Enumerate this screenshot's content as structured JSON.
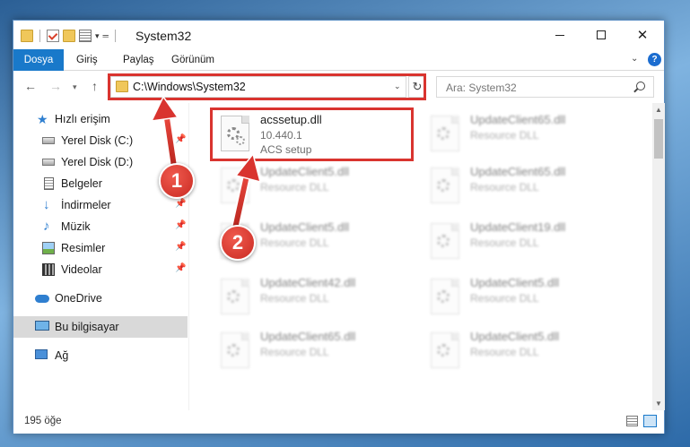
{
  "window": {
    "title": "System32"
  },
  "ribbon": {
    "tabs": [
      "Dosya",
      "Giriş",
      "Paylaş",
      "Görünüm"
    ],
    "help": "?"
  },
  "nav": {
    "address": "C:\\Windows\\System32",
    "search_placeholder": "Ara: System32"
  },
  "sidebar": {
    "items": [
      {
        "label": "Hızlı erişim",
        "icon": "star-icon",
        "pinned": false
      },
      {
        "label": "Yerel Disk (C:)",
        "icon": "drive-icon",
        "pinned": true
      },
      {
        "label": "Yerel Disk (D:)",
        "icon": "drive-icon",
        "pinned": false
      },
      {
        "label": "Belgeler",
        "icon": "documents-icon",
        "pinned": true
      },
      {
        "label": "İndirmeler",
        "icon": "downloads-icon",
        "pinned": true
      },
      {
        "label": "Müzik",
        "icon": "music-icon",
        "pinned": true
      },
      {
        "label": "Resimler",
        "icon": "pictures-icon",
        "pinned": true
      },
      {
        "label": "Videolar",
        "icon": "videos-icon",
        "pinned": true
      },
      {
        "label": "OneDrive",
        "icon": "onedrive-icon",
        "pinned": false
      },
      {
        "label": "Bu bilgisayar",
        "icon": "this-pc-icon",
        "pinned": false,
        "selected": true
      },
      {
        "label": "Ağ",
        "icon": "network-icon",
        "pinned": false
      }
    ]
  },
  "files": [
    {
      "name": "acssetup.dll",
      "line1": "10.440.1",
      "line2": "ACS setup",
      "highlighted": true
    },
    {
      "name": "UpdateClient65.dll",
      "line1": "Resource DLL",
      "line2": ""
    },
    {
      "name": "UpdateClient5.dll",
      "line1": "Resource DLL",
      "line2": ""
    },
    {
      "name": "UpdateClient65.dll",
      "line1": "Resource DLL",
      "line2": ""
    },
    {
      "name": "UpdateClient5.dll",
      "line1": "Resource DLL",
      "line2": ""
    },
    {
      "name": "UpdateClient19.dll",
      "line1": "Resource DLL",
      "line2": ""
    },
    {
      "name": "UpdateClient42.dll",
      "line1": "Resource DLL",
      "line2": ""
    },
    {
      "name": "UpdateClient5.dll",
      "line1": "Resource DLL",
      "line2": ""
    },
    {
      "name": "UpdateClient65.dll",
      "line1": "Resource DLL",
      "line2": ""
    },
    {
      "name": "UpdateClient5.dll",
      "line1": "Resource DLL",
      "line2": ""
    }
  ],
  "status": {
    "count": "195 öğe"
  },
  "annotations": {
    "step1": "1",
    "step2": "2",
    "highlight_color": "#d9342f"
  }
}
